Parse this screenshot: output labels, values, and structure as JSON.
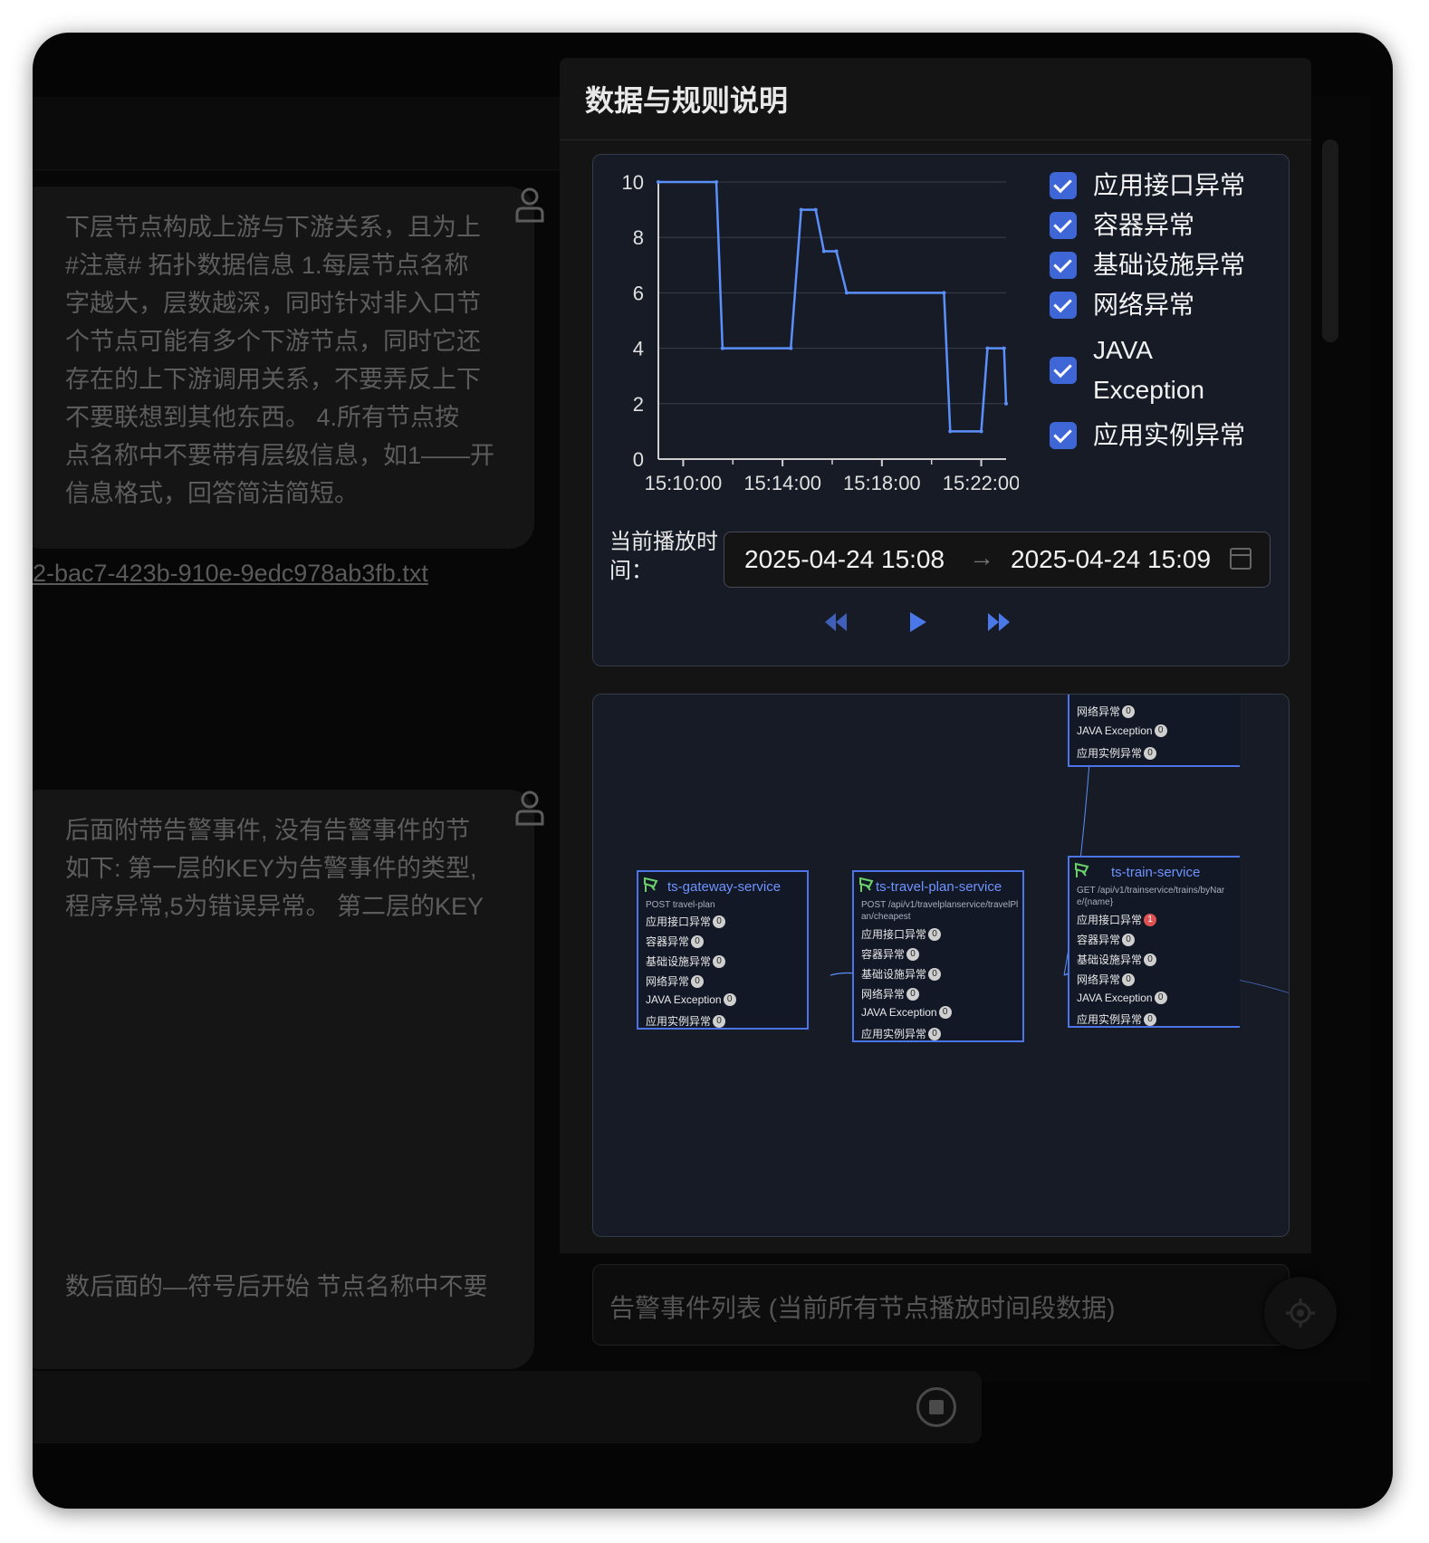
{
  "chat": {
    "bubble1": "下层节点构成上游与下游关系，且为上\n  #注意# 拓扑数据信息 1.每层节点名称\n字越大，层数越深，同时针对非入口节\n个节点可能有多个下游节点，同时它还\n存在的上下游调用关系，不要弄反上下\n不要联想到其他东西。 4.所有节点按\n点名称中不要带有层级信息，如1——开\n信息格式，回答简洁简短。",
    "file_link": "2-bac7-423b-910e-9edc978ab3fb.txt",
    "bubble2": "后面附带告警事件, 没有告警事件的节\n如下: 第一层的KEY为告警事件的类型,\n程序异常,5为错误异常。 第二层的KEY\n\n\n\n\n\n\n\n\n\n数后面的—符号后开始 节点名称中不要"
  },
  "drawer": {
    "title": "数据与规则说明",
    "time_label": "当前播放时\n间：",
    "range_start": "2025-04-24 15:08",
    "range_arrow": "→",
    "range_end": "2025-04-24 15:09",
    "alert_list_title": "告警事件列表 (当前所有节点播放时间段数据)"
  },
  "legend": [
    {
      "label": "应用接口异常",
      "checked": true
    },
    {
      "label": "容器异常",
      "checked": true
    },
    {
      "label": "基础设施异常",
      "checked": true
    },
    {
      "label": "网络异常",
      "checked": true
    },
    {
      "label": "JAVA\nException",
      "checked": true
    },
    {
      "label": "应用实例异常",
      "checked": true
    }
  ],
  "chart_data": {
    "type": "line",
    "title": "",
    "xlabel": "",
    "ylabel": "",
    "ylim": [
      0,
      10
    ],
    "yticks": [
      0,
      2,
      4,
      6,
      8,
      10
    ],
    "xtick_labels": [
      "15:10:00",
      "15:14:00",
      "15:18:00",
      "15:22:00"
    ],
    "x_domain": [
      "15:09:00",
      "15:23:00"
    ],
    "series": [
      {
        "color": "#5b8ff9",
        "points": [
          [
            "15:09:00",
            10
          ],
          [
            "15:11:20",
            10
          ],
          [
            "15:11:35",
            4
          ],
          [
            "15:14:20",
            4
          ],
          [
            "15:14:45",
            9
          ],
          [
            "15:15:20",
            9
          ],
          [
            "15:15:40",
            7.5
          ],
          [
            "15:16:10",
            7.5
          ],
          [
            "15:16:35",
            6
          ],
          [
            "15:20:30",
            6
          ],
          [
            "15:20:45",
            1
          ],
          [
            "15:22:00",
            1
          ],
          [
            "15:22:15",
            4
          ],
          [
            "15:22:55",
            4
          ],
          [
            "15:23:00",
            2
          ]
        ]
      }
    ],
    "grid": "horizontal"
  },
  "nodes": [
    {
      "name": "ts-gateway-service",
      "sub": "POST travel-plan",
      "metrics": [
        {
          "label": "应用接口异常",
          "count": "0"
        },
        {
          "label": "容器异常",
          "count": "0"
        },
        {
          "label": "基础设施异常",
          "count": "0"
        },
        {
          "label": "网络异常",
          "count": "0"
        },
        {
          "label": "JAVA Exception",
          "count": "0"
        },
        {
          "label": "应用实例异常",
          "count": "0"
        }
      ]
    },
    {
      "name": "ts-travel-plan-service",
      "sub": "POST /api/v1/travelplanservice/travelPl\nan/cheapest",
      "metrics": [
        {
          "label": "应用接口异常",
          "count": "0"
        },
        {
          "label": "容器异常",
          "count": "0"
        },
        {
          "label": "基础设施异常",
          "count": "0"
        },
        {
          "label": "网络异常",
          "count": "0"
        },
        {
          "label": "JAVA Exception",
          "count": "0"
        },
        {
          "label": "应用实例异常",
          "count": "0"
        }
      ]
    },
    {
      "name": "ts-train-service",
      "sub": "GET /api/v1/trainservice/trains/byNar\ne/{name}",
      "metrics": [
        {
          "label": "应用接口异常",
          "count": "1",
          "alert": true
        },
        {
          "label": "容器异常",
          "count": "0"
        },
        {
          "label": "基础设施异常",
          "count": "0"
        },
        {
          "label": "网络异常",
          "count": "0"
        },
        {
          "label": "JAVA Exception",
          "count": "0"
        },
        {
          "label": "应用实例异常",
          "count": "0"
        }
      ]
    },
    {
      "name": "",
      "sub": "",
      "metrics": [
        {
          "label": "网络异常",
          "count": "0"
        },
        {
          "label": "JAVA Exception",
          "count": "0"
        },
        {
          "label": "应用实例异常",
          "count": "0"
        }
      ]
    }
  ]
}
